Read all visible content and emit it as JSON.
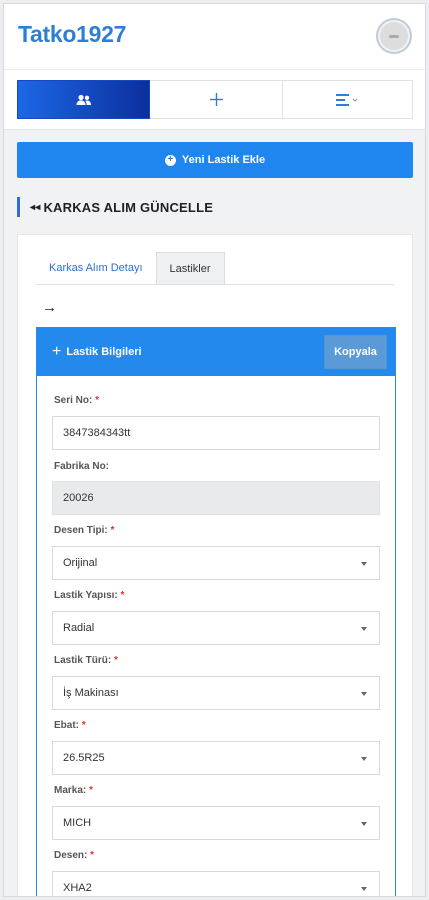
{
  "header": {
    "brand": "Tatko1927",
    "avatar_icon": "user-avatar-icon"
  },
  "toolbar": {
    "buttons": [
      {
        "icon": "users-icon",
        "active": true
      },
      {
        "icon": "plus-icon",
        "active": false
      },
      {
        "icon": "list-dropdown-icon",
        "active": false
      }
    ]
  },
  "actions": {
    "new_tire_label": "Yeni Lastik Ekle"
  },
  "section": {
    "title": "KARKAS ALIM GÜNCELLE"
  },
  "tabs": [
    {
      "label": "Karkas Alım Detayı"
    },
    {
      "label": "Lastikler"
    }
  ],
  "panel": {
    "title": "Lastik Bilgileri",
    "copy_label": "Kopyala",
    "fields": {
      "serial": {
        "label": "Seri No:",
        "required": "*",
        "value": "3847384343tt"
      },
      "factory": {
        "label": "Fabrika No:",
        "value": "20026"
      },
      "pattern_type": {
        "label": "Desen Tipi:",
        "required": "*",
        "value": "Orijinal"
      },
      "structure": {
        "label": "Lastik Yapısı:",
        "required": "*",
        "value": "Radial"
      },
      "tire_type": {
        "label": "Lastik Türü:",
        "required": "*",
        "value": "İş Makinası"
      },
      "size": {
        "label": "Ebat:",
        "required": "*",
        "value": "26.5R25"
      },
      "brand": {
        "label": "Marka:",
        "required": "*",
        "value": "MICH"
      },
      "pattern": {
        "label": "Desen:",
        "required": "*",
        "value": "XHA2"
      }
    }
  },
  "colors": {
    "primary": "#1f86ef",
    "brand": "#2d7fd6",
    "required": "#e03232",
    "panel_head": "#2389ec"
  }
}
